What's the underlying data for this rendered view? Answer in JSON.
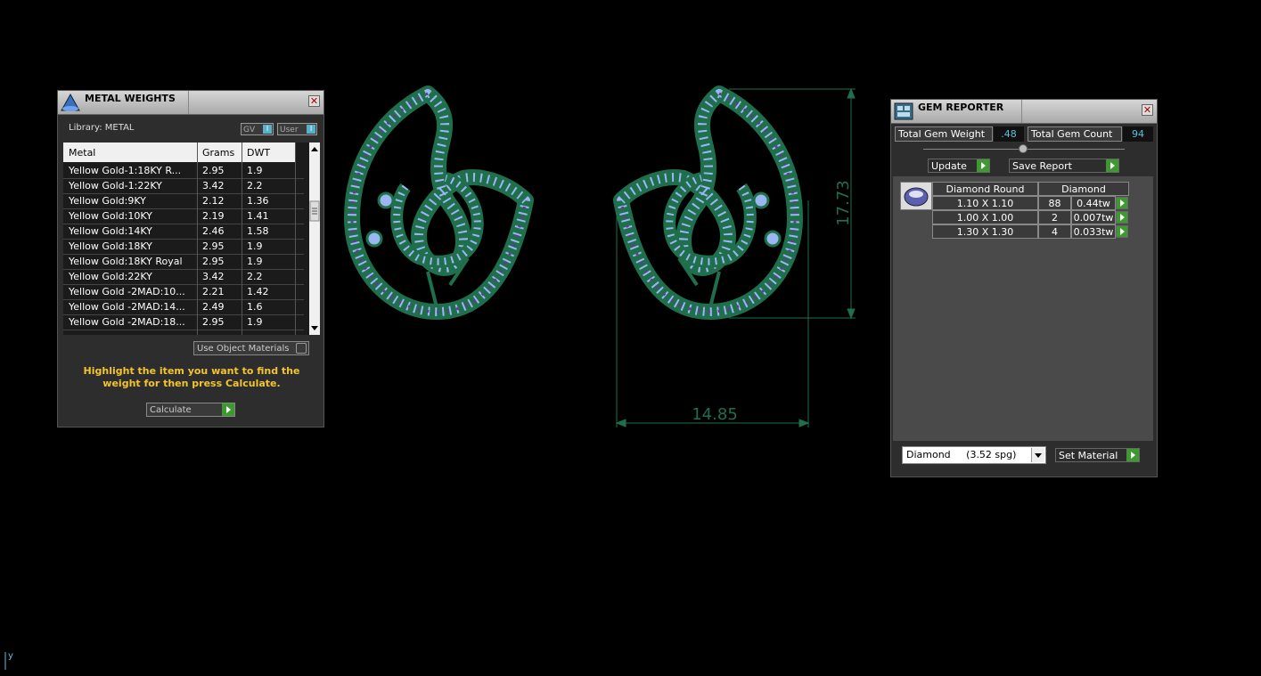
{
  "metal_weights": {
    "title": "METAL WEIGHTS",
    "library_label": "Library: METAL",
    "toggle_gv": "GV",
    "toggle_user": "User",
    "columns": [
      "Metal",
      "Grams",
      "DWT"
    ],
    "rows": [
      [
        "Yellow Gold-1:18KY R...",
        "2.95",
        "1.9"
      ],
      [
        "Yellow Gold-1:22KY",
        "3.42",
        "2.2"
      ],
      [
        "Yellow Gold:9KY",
        "2.12",
        "1.36"
      ],
      [
        "Yellow Gold:10KY",
        "2.19",
        "1.41"
      ],
      [
        "Yellow Gold:14KY",
        "2.46",
        "1.58"
      ],
      [
        "Yellow Gold:18KY",
        "2.95",
        "1.9"
      ],
      [
        "Yellow Gold:18KY Royal",
        "2.95",
        "1.9"
      ],
      [
        "Yellow Gold:22KY",
        "3.42",
        "2.2"
      ],
      [
        "Yellow Gold -2MAD:10...",
        "2.21",
        "1.42"
      ],
      [
        "Yellow Gold -2MAD:14...",
        "2.49",
        "1.6"
      ],
      [
        "Yellow Gold -2MAD:18...",
        "2.95",
        "1.9"
      ]
    ],
    "use_object_materials": "Use Object Materials",
    "hint": "Highlight the item you want to find the weight for then press Calculate.",
    "calculate": "Calculate"
  },
  "drawing": {
    "height_dim": "17.73",
    "width_dim": "14.85",
    "axis_label": "y",
    "metal_color": "#1f6e4c",
    "stone_color": "#9bb7f2",
    "accent_stone_color": "#7a2aa8"
  },
  "gem_reporter": {
    "title": "GEM REPORTER",
    "total_weight_label": "Total Gem Weight",
    "total_weight_value": ".48",
    "total_count_label": "Total Gem Count",
    "total_count_value": "94",
    "update": "Update",
    "save_report": "Save Report",
    "table_header_shape": "Diamond Round",
    "table_header_material": "Diamond",
    "rows": [
      [
        "1.10 X 1.10",
        "88",
        "0.44tw"
      ],
      [
        "1.00 X 1.00",
        "2",
        "0.007tw"
      ],
      [
        "1.30 X 1.30",
        "4",
        "0.033tw"
      ]
    ],
    "material_select": "Diamond     (3.52 spg)",
    "set_material": "Set Material"
  }
}
